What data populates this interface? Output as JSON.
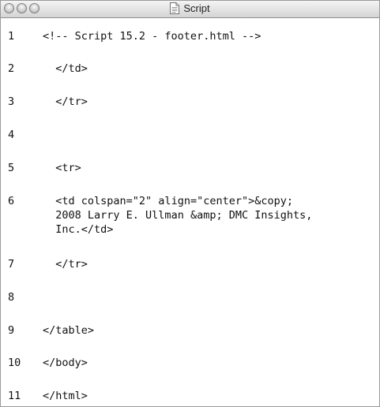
{
  "window": {
    "title": "Script",
    "icon": "document-icon"
  },
  "code": {
    "lines": [
      {
        "number": "1",
        "text": "<!-- Script 15.2 - footer.html -->"
      },
      {
        "number": "2",
        "text": "  </td>"
      },
      {
        "number": "3",
        "text": "  </tr>"
      },
      {
        "number": "4",
        "text": ""
      },
      {
        "number": "5",
        "text": "  <tr>"
      },
      {
        "number": "6",
        "text": "  <td colspan=\"2\" align=\"center\">&copy;\n  2008 Larry E. Ullman &amp; DMC Insights,\n  Inc.</td>"
      },
      {
        "number": "7",
        "text": "  </tr>"
      },
      {
        "number": "8",
        "text": ""
      },
      {
        "number": "9",
        "text": "</table>"
      },
      {
        "number": "10",
        "text": "</body>"
      },
      {
        "number": "11",
        "text": "</html>"
      }
    ]
  }
}
